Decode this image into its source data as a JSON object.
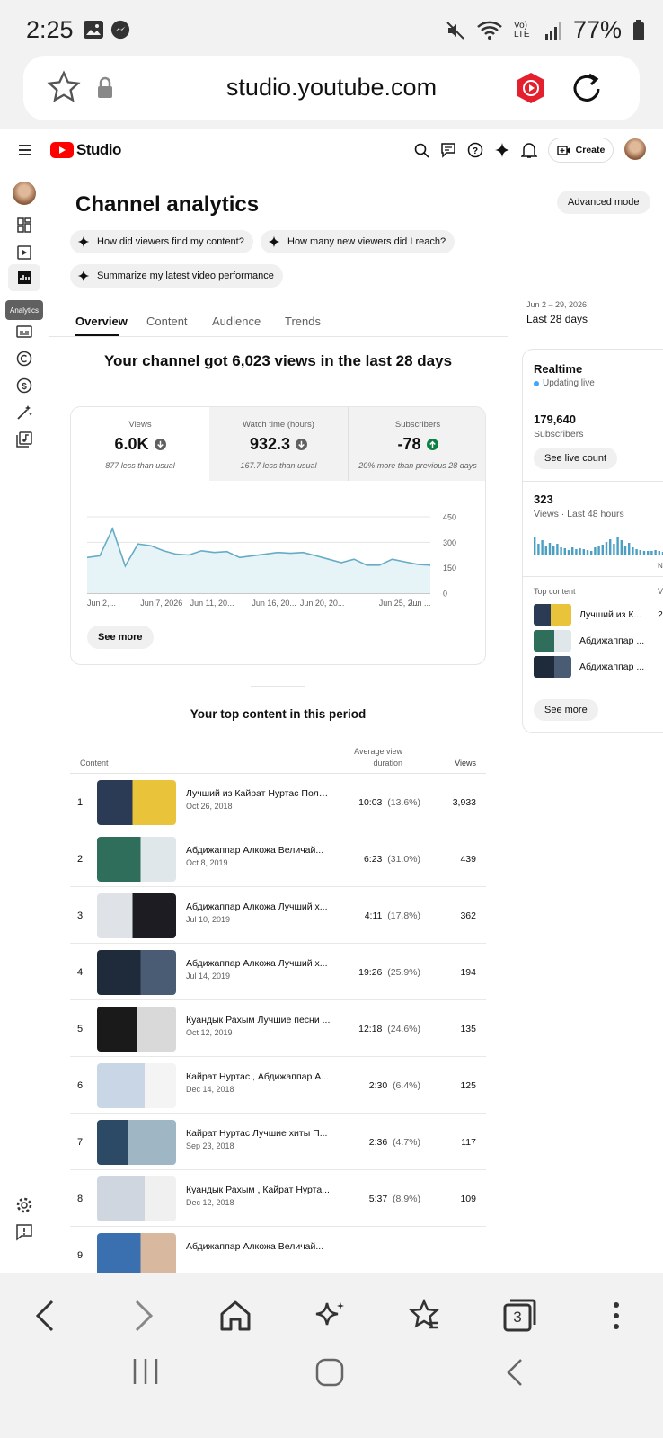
{
  "status_bar": {
    "time": "2:25",
    "signal": "Vo) LTE",
    "battery": "77%"
  },
  "browser": {
    "url": "studio.youtube.com",
    "tab_count": "3"
  },
  "header": {
    "logo_text": "Studio",
    "create_label": "Create"
  },
  "sidebar": {
    "tooltip": "Analytics"
  },
  "page": {
    "title": "Channel analytics",
    "advanced_mode": "Advanced mode",
    "suggestions": [
      "How did viewers find my content?",
      "How many new viewers did I reach?",
      "Summarize my latest video performance"
    ],
    "tabs": [
      "Overview",
      "Content",
      "Audience",
      "Trends"
    ],
    "date_range": "Jun 2 – 29, 2026",
    "date_label": "Last 28 days"
  },
  "summary": {
    "headline": "Your channel got 6,023 views in the last 28 days",
    "metrics": [
      {
        "label": "Views",
        "value": "6.0K",
        "note": "877 less than usual",
        "trend": "down"
      },
      {
        "label": "Watch time (hours)",
        "value": "932.3",
        "note": "167.7 less than usual",
        "trend": "down"
      },
      {
        "label": "Subscribers",
        "value": "-78",
        "note": "20% more than previous 28 days",
        "trend": "up"
      }
    ],
    "see_more": "See more"
  },
  "chart_data": {
    "type": "area",
    "x_ticks": [
      "Jun 2,...",
      "Jun 7, 2026",
      "Jun 11, 20...",
      "Jun 16, 20...",
      "Jun 20, 20...",
      "Jun 25, 2...",
      "Jun ..."
    ],
    "y_ticks": [
      "450",
      "300",
      "150",
      "0"
    ],
    "ylim": [
      0,
      450
    ],
    "values": [
      210,
      220,
      380,
      160,
      290,
      280,
      250,
      230,
      225,
      250,
      240,
      245,
      210,
      220,
      230,
      240,
      235,
      240,
      220,
      200,
      180,
      200,
      165,
      165,
      200,
      185,
      170,
      165
    ],
    "color": "#65acc7"
  },
  "realtime": {
    "title": "Realtime",
    "status": "Updating live",
    "subscribers_value": "179,640",
    "subscribers_label": "Subscribers",
    "see_live": "See live count",
    "views_value": "323",
    "views_label": "Views · Last 48 hours",
    "top_content_label": "Top content",
    "top_content_col": "Vi",
    "axis_letter": "N",
    "items": [
      {
        "title": "Лучший из К...",
        "views": "2"
      },
      {
        "title": "Абдижаппар ...",
        "views": ""
      },
      {
        "title": "Абдижаппар ...",
        "views": ""
      }
    ],
    "see_more": "See more"
  },
  "top_content": {
    "title": "Your top content in this period",
    "col_content": "Content",
    "col_avd": "Average view duration",
    "col_views": "Views",
    "rows": [
      {
        "n": "1",
        "title": "Лучший из Кайрат Нуртас Полн...",
        "date": "Oct 26, 2018",
        "avd": "10:03",
        "pct": "(13.6%)",
        "views": "3,933"
      },
      {
        "n": "2",
        "title": "Абдижаппар Алкожа Величай...",
        "date": "Oct 8, 2019",
        "avd": "6:23",
        "pct": "(31.0%)",
        "views": "439"
      },
      {
        "n": "3",
        "title": "Абдижаппар Алкожа Лучший х...",
        "date": "Jul 10, 2019",
        "avd": "4:11",
        "pct": "(17.8%)",
        "views": "362"
      },
      {
        "n": "4",
        "title": "Абдижаппар Алкожа Лучший х...",
        "date": "Jul 14, 2019",
        "avd": "19:26",
        "pct": "(25.9%)",
        "views": "194"
      },
      {
        "n": "5",
        "title": "Куандык Рахым Лучшие песни ...",
        "date": "Oct 12, 2019",
        "avd": "12:18",
        "pct": "(24.6%)",
        "views": "135"
      },
      {
        "n": "6",
        "title": "Кайрат Нуртас , Абдижаппар А...",
        "date": "Dec 14, 2018",
        "avd": "2:30",
        "pct": "(6.4%)",
        "views": "125"
      },
      {
        "n": "7",
        "title": "Кайрат Нуртас Лучшие хиты П...",
        "date": "Sep 23, 2018",
        "avd": "2:36",
        "pct": "(4.7%)",
        "views": "117"
      },
      {
        "n": "8",
        "title": "Куандык Рахым , Кайрат Нурта...",
        "date": "Dec 12, 2018",
        "avd": "5:37",
        "pct": "(8.9%)",
        "views": "109"
      },
      {
        "n": "9",
        "title": "Абдижаппар Алкожа Величай...",
        "date": "",
        "avd": "",
        "pct": "",
        "views": ""
      }
    ]
  }
}
